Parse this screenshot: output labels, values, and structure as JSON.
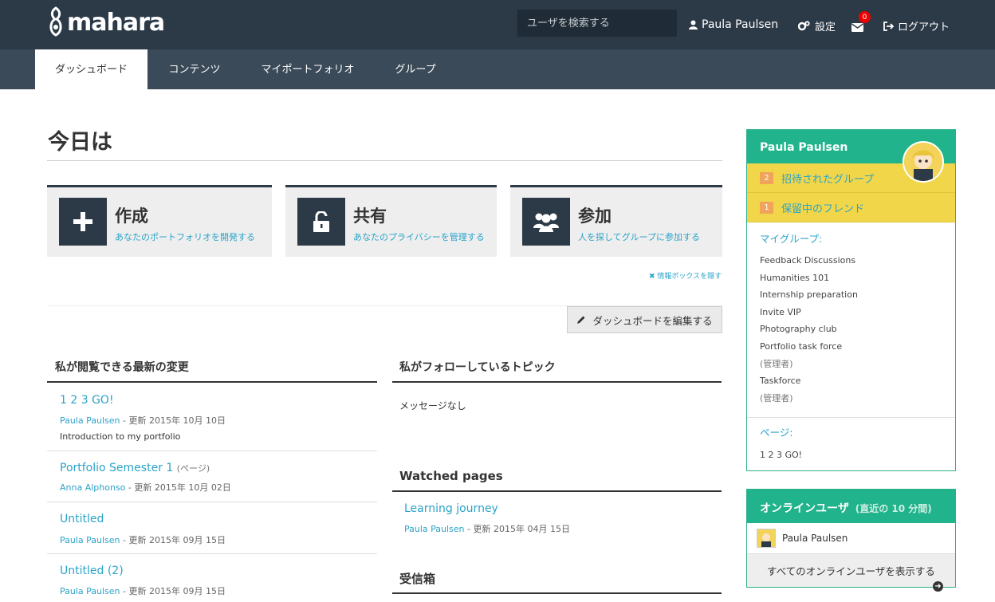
{
  "header": {
    "logo_text": "mahara",
    "search_placeholder": "ユーザを検索する",
    "user_name": "Paula Paulsen",
    "settings_label": "設定",
    "inbox_count": "0",
    "logout_label": "ログアウト"
  },
  "nav": {
    "tabs": [
      {
        "label": "ダッシュボード"
      },
      {
        "label": "コンテンツ"
      },
      {
        "label": "マイポートフォリオ"
      },
      {
        "label": "グループ"
      }
    ]
  },
  "page": {
    "title": "今日は",
    "info_boxes": [
      {
        "title": "作成",
        "subtitle": "あなたのポートフォリオを開発する",
        "icon": "plus-icon"
      },
      {
        "title": "共有",
        "subtitle": "あなたのプライバシーを管理する",
        "icon": "unlock-icon"
      },
      {
        "title": "参加",
        "subtitle": "人を探してグループに参加する",
        "icon": "users-icon"
      }
    ],
    "hide_info": "情報ボックスを隠す",
    "edit_dashboard": "ダッシュボードを編集する"
  },
  "recent": {
    "title": "私が閲覧できる最新の変更",
    "items": [
      {
        "title": "1 2 3 GO!",
        "type": "",
        "author": "Paula Paulsen",
        "updated": " - 更新 2015年 10月 10日",
        "desc": "Introduction to my portfolio"
      },
      {
        "title": "Portfolio Semester 1",
        "type": "(ページ)",
        "author": "Anna Alphonso",
        "updated": " - 更新 2015年 10月 02日",
        "desc": ""
      },
      {
        "title": "Untitled",
        "type": "",
        "author": "Paula Paulsen",
        "updated": " - 更新 2015年 09月 15日",
        "desc": ""
      },
      {
        "title": "Untitled (2)",
        "type": "",
        "author": "Paula Paulsen",
        "updated": " - 更新 2015年 09月 15日",
        "desc": ""
      }
    ]
  },
  "topics": {
    "title": "私がフォローしているトピック",
    "empty": "メッセージなし"
  },
  "watched": {
    "title": "Watched pages",
    "item_title": "Learning journey",
    "author": "Paula Paulsen",
    "updated": " - 更新 2015年 04月 15日"
  },
  "inbox": {
    "title": "受信箱"
  },
  "sidebar": {
    "name": "Paula Paulsen",
    "invites_count": "2",
    "invites_label": "招待されたグループ",
    "pending_count": "1",
    "pending_label": "保留中のフレンド",
    "mygroups_label": "マイグループ:",
    "groups": [
      "Feedback Discussions",
      "Humanities 101",
      "Internship preparation",
      "Invite VIP",
      "Photography club",
      "Portfolio task force",
      "(管理者)",
      "Taskforce",
      "(管理者)"
    ],
    "pages_label": "ページ:",
    "page_item": "1 2 3 GO!"
  },
  "online": {
    "title": "オンラインユーザ",
    "subtitle": "(直近の 10 分間)",
    "user": "Paula Paulsen",
    "show_all": "すべてのオンラインユーザを表示する"
  }
}
